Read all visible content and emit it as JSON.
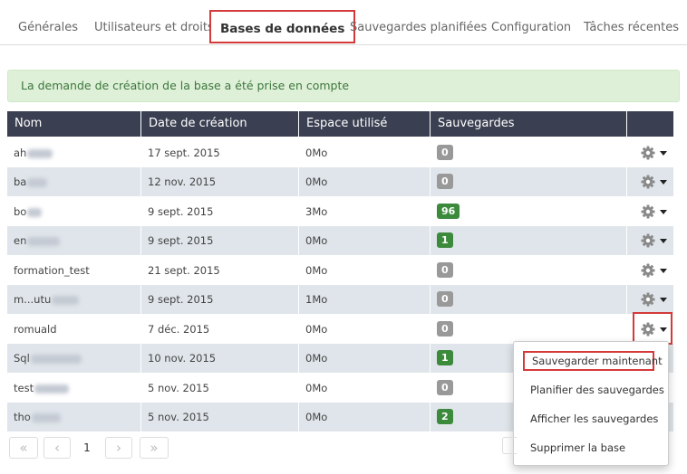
{
  "tabs": [
    {
      "label": "Générales"
    },
    {
      "label": "Utilisateurs et droits"
    },
    {
      "label": "Bases de données",
      "active": true
    },
    {
      "label": "Sauvegardes planifiées"
    },
    {
      "label": "Configuration"
    },
    {
      "label": "Tâches récentes"
    }
  ],
  "alert": {
    "message": "La demande de création de la base a été prise en compte"
  },
  "table": {
    "headers": [
      "Nom",
      "Date de création",
      "Espace utilisé",
      "Sauvegardes"
    ],
    "rows": [
      {
        "name": "ah",
        "date": "17 sept. 2015",
        "space": "0Mo",
        "backups": "0"
      },
      {
        "name": "ba",
        "date": "12 nov. 2015",
        "space": "0Mo",
        "backups": "0"
      },
      {
        "name": "bo",
        "date": "9 sept. 2015",
        "space": "3Mo",
        "backups": "96"
      },
      {
        "name": "en",
        "date": "9 sept. 2015",
        "space": "0Mo",
        "backups": "1"
      },
      {
        "name": "formation_test",
        "date": "21 sept. 2015",
        "space": "0Mo",
        "backups": "0"
      },
      {
        "name": "m...utu",
        "date": "9 sept. 2015",
        "space": "1Mo",
        "backups": "0"
      },
      {
        "name": "romuald",
        "date": "7 déc. 2015",
        "space": "0Mo",
        "backups": "0"
      },
      {
        "name": "Sql",
        "date": "10 nov. 2015",
        "space": "0Mo",
        "backups": "1"
      },
      {
        "name": "test",
        "date": "5 nov. 2015",
        "space": "0Mo",
        "backups": "0"
      },
      {
        "name": "tho",
        "date": "5 nov. 2015",
        "space": "0Mo",
        "backups": "2"
      }
    ]
  },
  "actions_menu": {
    "items": [
      "Sauvegarder maintenant",
      "Planifier des sauvegardes",
      "Afficher les sauvegardes",
      "Supprimer la base"
    ]
  },
  "pagination": {
    "first": "«",
    "prev": "‹",
    "page": "1",
    "next": "›",
    "last": "»"
  },
  "icons": {
    "row_action": "gear-icon",
    "dropdown": "caret-down-icon"
  },
  "colors": {
    "header_bg": "#3a3f51",
    "alert_bg": "#dff0d8",
    "alert_text": "#3c763d",
    "badge_zero": "#999999",
    "badge_positive": "#3c8a3c",
    "highlight": "#d43a3a"
  }
}
